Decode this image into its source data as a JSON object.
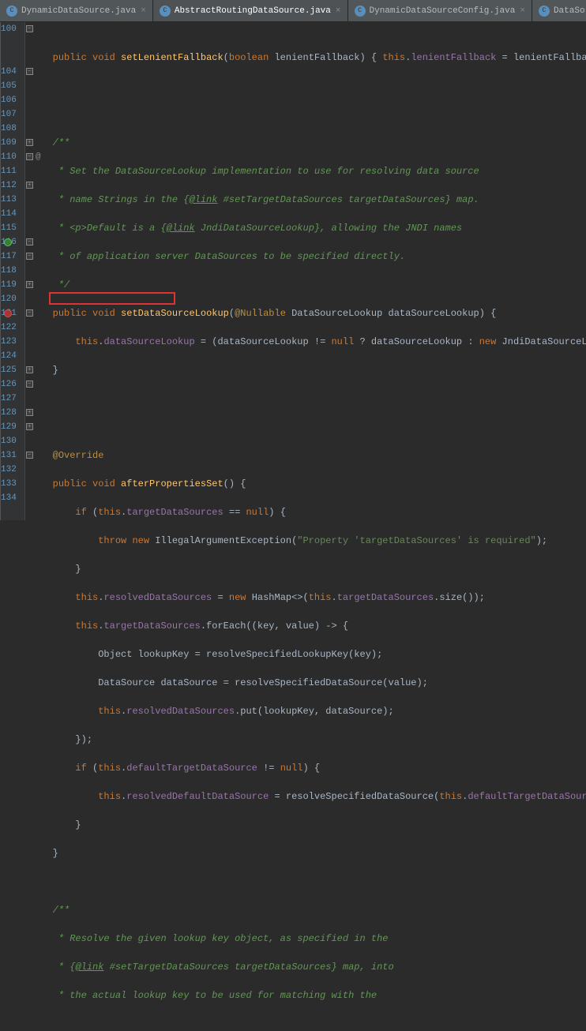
{
  "tabs": {
    "t0": "DynamicDataSource.java",
    "t1": "AbstractRoutingDataSource.java",
    "t2": "DynamicDataSourceConfig.java",
    "t3": "DataSo"
  },
  "gutter": {
    "l100": "100",
    "l104": "104",
    "l105": "105",
    "l106": "106",
    "l107": "107",
    "l108": "108",
    "l109": "109",
    "l110": "110",
    "l111": "111",
    "l112": "112",
    "l113": "113",
    "l114": "114",
    "l115": "115",
    "l116": "116",
    "l117": "117",
    "l118": "118",
    "l119": "119",
    "l120": "120",
    "l121": "121",
    "l122": "122",
    "l123": "123",
    "l124": "124",
    "l125": "125",
    "l126": "126",
    "l127": "127",
    "l128": "128",
    "l129": "129",
    "l130": "130",
    "l131": "131",
    "l132": "132",
    "l133": "133",
    "l134": "134"
  },
  "code": {
    "l100a": "public void ",
    "l100b": "setLenientFallback",
    "l100c": "(",
    "l100d": "boolean ",
    "l100e": "lenientFallback) { ",
    "l100f": "this",
    "l100g": ".",
    "l100h": "lenientFallback",
    "l100i": " = lenientFallback; }",
    "l104": "/**",
    "l105": " * Set the DataSourceLookup implementation to use for resolving data source",
    "l106a": " * name Strings in the {",
    "l106b": "@link",
    "l106c": " #setTargetDataSources targetDataSources} map.",
    "l107a": " * <p>Default is a {",
    "l107b": "@link",
    "l107c": " JndiDataSourceLookup}, allowing the JNDI names",
    "l108": " * of application server DataSources to be specified directly.",
    "l109": " */",
    "l110a": "public void ",
    "l110b": "setDataSourceLookup",
    "l110c": "(",
    "l110d": "@Nullable",
    "l110e": " DataSourceLookup dataSourceLookup) {",
    "l111a": "this",
    "l111b": ".",
    "l111c": "dataSourceLookup",
    "l111d": " = (dataSourceLookup != ",
    "l111e": "null",
    "l111f": " ? dataSourceLookup : ",
    "l111g": "new ",
    "l111h": "JndiDataSourceLookup());",
    "l112": "}",
    "l115": "@Override",
    "l116a": "public void ",
    "l116b": "afterPropertiesSet",
    "l116c": "() {",
    "l117a": "if ",
    "l117b": "(",
    "l117c": "this",
    "l117d": ".",
    "l117e": "targetDataSources",
    "l117f": " == ",
    "l117g": "null",
    "l117h": ") {",
    "l118a": "throw new ",
    "l118b": "IllegalArgumentException(",
    "l118c": "\"Property 'targetDataSources' is required\"",
    "l118d": ");",
    "l119": "}",
    "l120a": "this",
    "l120b": ".",
    "l120c": "resolvedDataSources",
    "l120d": " = ",
    "l120e": "new ",
    "l120f": "HashMap<>(",
    "l120g": "this",
    "l120h": ".",
    "l120i": "targetDataSources",
    "l120j": ".size());",
    "l121a": "this",
    "l121b": ".",
    "l121c": "targetDataSources",
    "l121d": ".forEach((key, value) -> {",
    "l122": "Object lookupKey = resolveSpecifiedLookupKey(key);",
    "l123": "DataSource dataSource = resolveSpecifiedDataSource(value);",
    "l124a": "this",
    "l124b": ".",
    "l124c": "resolvedDataSources",
    "l124d": ".put(lookupKey, dataSource);",
    "l125": "});",
    "l126a": "if ",
    "l126b": "(",
    "l126c": "this",
    "l126d": ".",
    "l126e": "defaultTargetDataSource",
    "l126f": " != ",
    "l126g": "null",
    "l126h": ") {",
    "l127a": "this",
    "l127b": ".",
    "l127c": "resolvedDefaultDataSource",
    "l127d": " = resolveSpecifiedDataSource(",
    "l127e": "this",
    "l127f": ".",
    "l127g": "defaultTargetDataSource",
    "l127h": ");",
    "l128": "}",
    "l129": "}",
    "l131": "/**",
    "l132": " * Resolve the given lookup key object, as specified in the",
    "l133a": " * {",
    "l133b": "@link",
    "l133c": " #setTargetDataSources targetDataSources} map, into",
    "l134": " * the actual lookup key to be used for matching with the"
  }
}
